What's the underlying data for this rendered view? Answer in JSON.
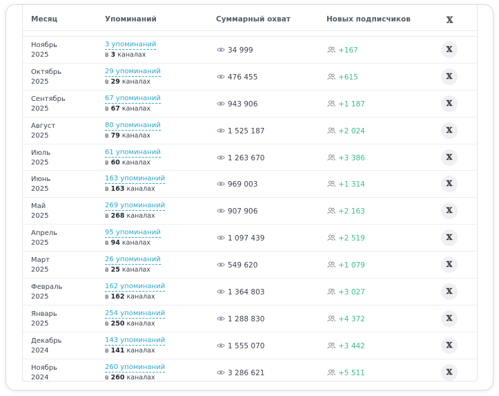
{
  "header": {
    "month": "Месяц",
    "mentions": "Упоминаний",
    "reach": "Суммарный охват",
    "subscribers": "Новых подписчиков",
    "x": "𝕏"
  },
  "rows": [
    {
      "month": "Ноябрь",
      "year": "2025",
      "mentions": "3 упоминаний",
      "channels_pre": "в ",
      "channels_num": "3",
      "channels_post": " каналах",
      "reach": "34 999",
      "subs": "+167"
    },
    {
      "month": "Октябрь",
      "year": "2025",
      "mentions": "29 упоминаний",
      "channels_pre": "в ",
      "channels_num": "29",
      "channels_post": " каналах",
      "reach": "476 455",
      "subs": "+615"
    },
    {
      "month": "Сентябрь",
      "year": "2025",
      "mentions": "67 упоминаний",
      "channels_pre": "в ",
      "channels_num": "67",
      "channels_post": " каналах",
      "reach": "943 906",
      "subs": "+1 187"
    },
    {
      "month": "Август",
      "year": "2025",
      "mentions": "80 упоминаний",
      "channels_pre": "в ",
      "channels_num": "79",
      "channels_post": " каналах",
      "reach": "1 525 187",
      "subs": "+2 024"
    },
    {
      "month": "Июль",
      "year": "2025",
      "mentions": "61 упоминаний",
      "channels_pre": "в ",
      "channels_num": "60",
      "channels_post": " каналах",
      "reach": "1 263 670",
      "subs": "+3 386"
    },
    {
      "month": "Июнь",
      "year": "2025",
      "mentions": "163 упоминаний",
      "channels_pre": "в ",
      "channels_num": "163",
      "channels_post": " каналах",
      "reach": "969 003",
      "subs": "+1 314"
    },
    {
      "month": "Май",
      "year": "2025",
      "mentions": "269 упоминаний",
      "channels_pre": "в ",
      "channels_num": "268",
      "channels_post": " каналах",
      "reach": "907 906",
      "subs": "+2 163"
    },
    {
      "month": "Апрель",
      "year": "2025",
      "mentions": "95 упоминаний",
      "channels_pre": "в ",
      "channels_num": "94",
      "channels_post": " каналах",
      "reach": "1 097 439",
      "subs": "+2 519"
    },
    {
      "month": "Март",
      "year": "2025",
      "mentions": "26 упоминаний",
      "channels_pre": "в ",
      "channels_num": "25",
      "channels_post": " каналах",
      "reach": "549 620",
      "subs": "+1 079"
    },
    {
      "month": "Февраль",
      "year": "2025",
      "mentions": "162 упоминаний",
      "channels_pre": "в ",
      "channels_num": "162",
      "channels_post": " каналах",
      "reach": "1 364 803",
      "subs": "+3 027"
    },
    {
      "month": "Январь",
      "year": "2025",
      "mentions": "254 упоминаний",
      "channels_pre": "в ",
      "channels_num": "250",
      "channels_post": " каналах",
      "reach": "1 288 830",
      "subs": "+4 372"
    },
    {
      "month": "Декабрь",
      "year": "2024",
      "mentions": "143 упоминаний",
      "channels_pre": "в ",
      "channels_num": "141",
      "channels_post": " каналах",
      "reach": "1 555 070",
      "subs": "+3 442"
    },
    {
      "month": "Ноябрь",
      "year": "2024",
      "mentions": "260 упоминаний",
      "channels_pre": "в ",
      "channels_num": "260",
      "channels_post": " каналах",
      "reach": "3 286 621",
      "subs": "+5 511"
    }
  ],
  "icons": {
    "reach": "eye-icon",
    "subscribers": "users-icon",
    "action": "x-logo-icon"
  },
  "colors": {
    "link": "#2ea8c8",
    "positive": "#3dbf8a"
  }
}
